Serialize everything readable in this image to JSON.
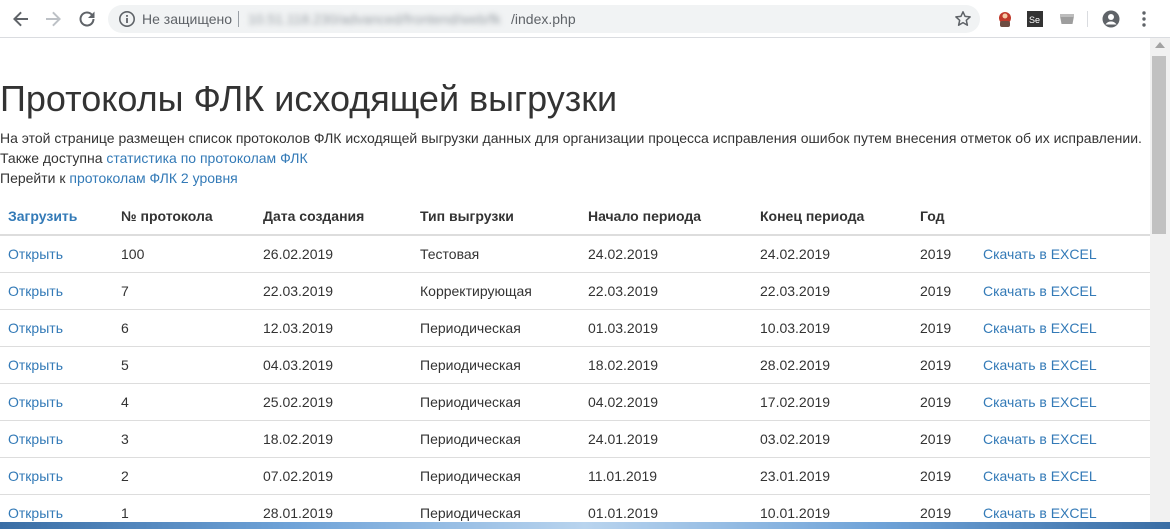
{
  "browser": {
    "security_label": "Не защищено",
    "host": "10.51.118.230/advanced/frontend/web/fk",
    "path": "/index.php"
  },
  "page": {
    "title": "Протоколы ФЛК исходящей выгрузки",
    "description": "На этой странице размещен список протоколов ФЛК исходящей выгрузки данных для организации процесса исправления ошибок путем внесения отметок об их исправлении.",
    "stats_prefix": "Также доступна",
    "stats_link": "статистика по протоколам ФЛК",
    "level2_prefix": "Перейти к",
    "level2_link": "протоколам ФЛК 2 уровня"
  },
  "table": {
    "headers": {
      "upload": "Загрузить",
      "number": "№ протокола",
      "created": "Дата создания",
      "type": "Тип выгрузки",
      "period_start": "Начало периода",
      "period_end": "Конец периода",
      "year": "Год"
    },
    "rows": [
      {
        "open": "Открыть",
        "number": "100",
        "created": "26.02.2019",
        "type": "Тестовая",
        "start": "24.02.2019",
        "end": "24.02.2019",
        "year": "2019",
        "excel": "Скачать в EXCEL"
      },
      {
        "open": "Открыть",
        "number": "7",
        "created": "22.03.2019",
        "type": "Корректирующая",
        "start": "22.03.2019",
        "end": "22.03.2019",
        "year": "2019",
        "excel": "Скачать в EXCEL"
      },
      {
        "open": "Открыть",
        "number": "6",
        "created": "12.03.2019",
        "type": "Периодическая",
        "start": "01.03.2019",
        "end": "10.03.2019",
        "year": "2019",
        "excel": "Скачать в EXCEL"
      },
      {
        "open": "Открыть",
        "number": "5",
        "created": "04.03.2019",
        "type": "Периодическая",
        "start": "18.02.2019",
        "end": "28.02.2019",
        "year": "2019",
        "excel": "Скачать в EXCEL"
      },
      {
        "open": "Открыть",
        "number": "4",
        "created": "25.02.2019",
        "type": "Периодическая",
        "start": "04.02.2019",
        "end": "17.02.2019",
        "year": "2019",
        "excel": "Скачать в EXCEL"
      },
      {
        "open": "Открыть",
        "number": "3",
        "created": "18.02.2019",
        "type": "Периодическая",
        "start": "24.01.2019",
        "end": "03.02.2019",
        "year": "2019",
        "excel": "Скачать в EXCEL"
      },
      {
        "open": "Открыть",
        "number": "2",
        "created": "07.02.2019",
        "type": "Периодическая",
        "start": "11.01.2019",
        "end": "23.01.2019",
        "year": "2019",
        "excel": "Скачать в EXCEL"
      },
      {
        "open": "Открыть",
        "number": "1",
        "created": "28.01.2019",
        "type": "Периодическая",
        "start": "01.01.2019",
        "end": "10.01.2019",
        "year": "2019",
        "excel": "Скачать в EXCEL"
      }
    ]
  },
  "colors": {
    "link": "#337ab7",
    "text": "#333333",
    "border": "#dddddd"
  },
  "icons": [
    "back-arrow-icon",
    "forward-arrow-icon",
    "reload-icon",
    "info-icon",
    "star-icon",
    "extension-icon",
    "selenium-extension-icon",
    "profile-icon",
    "menu-dots-icon"
  ]
}
